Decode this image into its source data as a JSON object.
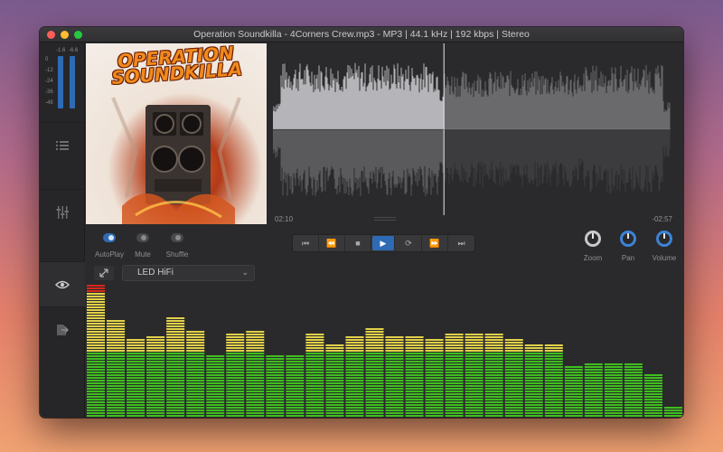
{
  "window": {
    "title": "Operation Soundkilla - 4Corners Crew.mp3 - MP3 | 44.1 kHz | 192 kbps | Stereo"
  },
  "meter": {
    "top_labels": [
      "-1.6",
      "-6.6"
    ],
    "db_labels": [
      "0",
      "-12",
      "-24",
      "-36",
      "-48"
    ],
    "bar_color": "#2e6bb4"
  },
  "sidebar": {
    "items": [
      {
        "name": "playlist",
        "icon": "list-icon",
        "active": false
      },
      {
        "name": "equalizer",
        "icon": "sliders-icon",
        "active": false
      },
      {
        "name": "visualizer",
        "icon": "eye-icon",
        "active": true
      },
      {
        "name": "export",
        "icon": "export-icon",
        "active": false
      }
    ]
  },
  "album_art": {
    "text": "OPERATION SOUNDKILLA",
    "icon": "album-art-speakers"
  },
  "waveform": {
    "elapsed": "02:10",
    "remaining": "-02:57",
    "played_color": "#b5b5b9",
    "unplayed_color": "#6a6a6d",
    "playhead_fraction": 0.43
  },
  "toggles": [
    {
      "label": "AutoPlay",
      "on": true
    },
    {
      "label": "Mute",
      "on": false
    },
    {
      "label": "Shuffle",
      "on": false
    }
  ],
  "transport": {
    "buttons": [
      {
        "name": "skip-back",
        "icon": "skip-back-icon",
        "glyph": "⏮"
      },
      {
        "name": "rewind",
        "icon": "rewind-icon",
        "glyph": "⏪"
      },
      {
        "name": "stop",
        "icon": "stop-icon",
        "glyph": "■"
      },
      {
        "name": "play",
        "icon": "play-icon",
        "glyph": "▶"
      },
      {
        "name": "repeat",
        "icon": "repeat-icon",
        "glyph": "⟳"
      },
      {
        "name": "fast-forward",
        "icon": "fast-forward-icon",
        "glyph": "⏩"
      },
      {
        "name": "skip-forward",
        "icon": "skip-forward-icon",
        "glyph": "⏭"
      }
    ]
  },
  "knobs": [
    {
      "label": "Zoom",
      "active": false
    },
    {
      "label": "Pan",
      "active": true
    },
    {
      "label": "Volume",
      "active": true
    }
  ],
  "visualizer": {
    "mode": "LED HiFi",
    "green": "#3fbf1f",
    "yellow": "#e2d14a",
    "red": "#d6261b",
    "bands": [
      0.92,
      0.72,
      0.58,
      0.6,
      0.74,
      0.64,
      0.45,
      0.62,
      0.64,
      0.45,
      0.45,
      0.61,
      0.54,
      0.6,
      0.66,
      0.6,
      0.6,
      0.58,
      0.61,
      0.61,
      0.62,
      0.58,
      0.53,
      0.53,
      0.38,
      0.41,
      0.39,
      0.39,
      0.31,
      0.07
    ],
    "peak_band": 0
  }
}
